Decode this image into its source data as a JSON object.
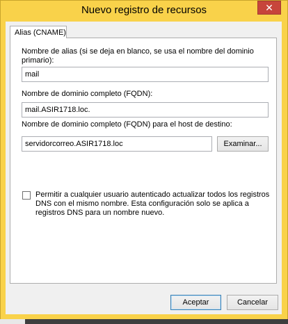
{
  "window": {
    "title": "Nuevo registro de recursos",
    "close_label": "✕"
  },
  "tab": {
    "label": "Alias (CNAME)"
  },
  "alias": {
    "label": "Nombre de alias (si se deja en blanco, se usa el nombre del dominio primario):",
    "value": "mail"
  },
  "fqdn": {
    "label": "Nombre de dominio completo (FQDN):",
    "value": "mail.ASIR1718.loc."
  },
  "target": {
    "label": "Nombre de dominio completo (FQDN) para el host de destino:",
    "value": "servidorcorreo.ASIR1718.loc",
    "browse_label": "Examinar..."
  },
  "permission": {
    "checked": false,
    "label": "Permitir a cualquier usuario autenticado actualizar todos los registros DNS con el mismo nombre. Esta configuración solo se aplica a registros DNS para un nombre nuevo."
  },
  "buttons": {
    "ok_label": "Aceptar",
    "cancel_label": "Cancelar"
  }
}
